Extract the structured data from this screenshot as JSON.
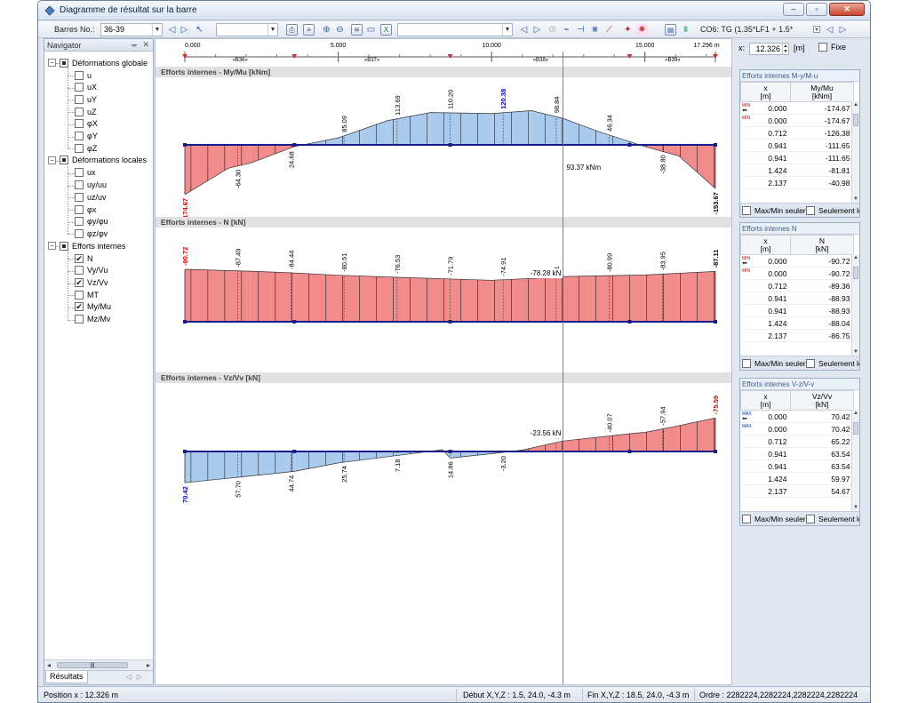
{
  "window": {
    "title": "Diagramme de résultat sur la barre",
    "buttons": [
      "–",
      "▫",
      "✕"
    ]
  },
  "toolbar": {
    "members_label": "Barres No.:",
    "members_value": "36-39",
    "combo2_value": "",
    "combo3_value": "",
    "load_combo": "CO6: TG  (1.35*LF1 + 1.5*"
  },
  "navigator": {
    "title": "Navigator",
    "tab": "Résultats",
    "groups": [
      {
        "label": "Déformations globale",
        "state": "partial",
        "items": [
          {
            "label": "u",
            "checked": false
          },
          {
            "label": "uX",
            "checked": false
          },
          {
            "label": "uY",
            "checked": false
          },
          {
            "label": "uZ",
            "checked": false
          },
          {
            "label": "φX",
            "checked": false
          },
          {
            "label": "φY",
            "checked": false
          },
          {
            "label": "φZ",
            "checked": false
          }
        ]
      },
      {
        "label": "Déformations locales",
        "state": "partial",
        "items": [
          {
            "label": "ux",
            "checked": false
          },
          {
            "label": "uy/uu",
            "checked": false
          },
          {
            "label": "uz/uv",
            "checked": false
          },
          {
            "label": "φx",
            "checked": false
          },
          {
            "label": "φy/φu",
            "checked": false
          },
          {
            "label": "φz/φv",
            "checked": false
          }
        ]
      },
      {
        "label": "Efforts internes",
        "state": "partial",
        "items": [
          {
            "label": "N",
            "checked": true
          },
          {
            "label": "Vy/Vu",
            "checked": false
          },
          {
            "label": "Vz/Vv",
            "checked": true
          },
          {
            "label": "MT",
            "checked": false
          },
          {
            "label": "My/Mu",
            "checked": true
          },
          {
            "label": "Mz/Mv",
            "checked": false
          }
        ]
      }
    ]
  },
  "ruler": {
    "ticks": [
      "0.000",
      "5.000",
      "10.000",
      "15.000",
      "17.296 m"
    ],
    "bars": [
      "»B36»",
      "»B37»",
      "»B38»",
      "»B39»"
    ]
  },
  "position_control": {
    "x_label": "x:",
    "x_value": "12.326",
    "unit": "[m]",
    "fix_label": "Fixe"
  },
  "chart_data": [
    {
      "type": "area",
      "title": "Efforts internes - My/Mu [kNm]",
      "x": [
        0.0,
        1.424,
        2.137,
        3.57,
        5.0,
        6.6,
        8.0,
        10.0,
        11.3,
        12.326,
        13.5,
        15.0,
        16.1,
        17.296
      ],
      "values": [
        -174.67,
        -81.81,
        -64.3,
        -6.0,
        24.68,
        85.09,
        113.69,
        110.2,
        120.38,
        93.37,
        46.34,
        -6.0,
        -38.8,
        -153.67
      ],
      "labels": [
        "-174.67",
        "-64.30",
        "24.68",
        "85.09",
        "113.69",
        "110.20",
        "120.38",
        "98.84",
        "46.34",
        "-38.80",
        "-153.67"
      ],
      "cursor_label": "93.37 kNm"
    },
    {
      "type": "area",
      "title": "Efforts internes - N [kN]",
      "x": [
        0.0,
        2.137,
        3.57,
        5.0,
        7.14,
        10.0,
        11.3,
        12.326,
        15.0,
        16.1,
        17.296
      ],
      "values": [
        -90.72,
        -87.49,
        -84.44,
        -80.51,
        -76.53,
        -71.79,
        -74.91,
        -78.28,
        -80.99,
        -83.95,
        -87.11
      ],
      "labels": [
        "-90.72",
        "-87.49",
        "-84.44",
        "-80.51",
        "-76.53",
        "-71.79",
        "-74.91",
        "91",
        "-80.99",
        "-83.95",
        "-87.11"
      ],
      "cursor_label": "-78.28 kN"
    },
    {
      "type": "area",
      "title": "Efforts internes - Vz/Vv [kN]",
      "x": [
        0.0,
        1.77,
        3.57,
        5.0,
        7.14,
        8.4,
        8.65,
        10.0,
        11.0,
        12.326,
        14.5,
        15.0,
        16.1,
        17.296
      ],
      "values": [
        70.42,
        57.7,
        44.74,
        25.74,
        7.18,
        -4.0,
        14.86,
        5.0,
        -3.2,
        -23.56,
        -40.07,
        -43.0,
        -57.94,
        -75.59
      ],
      "labels": [
        "70.42",
        "57.70",
        "44.74",
        "25.74",
        "7.18",
        "14.86",
        "-3.20",
        "28",
        "-40.07",
        "-57.94",
        "-75.59"
      ],
      "cursor_label": "-23.56 kN"
    }
  ],
  "tables": [
    {
      "title": "Efforts internes M-y/M-u",
      "col1": "x\n[m]",
      "col2": "My/Mu\n[kNm]",
      "flag": "MIN",
      "rows": [
        [
          "0.000",
          "-174.67"
        ],
        [
          "0.000",
          "-174.67"
        ],
        [
          "0.712",
          "-126.38"
        ],
        [
          "0.941",
          "-111.65"
        ],
        [
          "0.941",
          "-111.65"
        ],
        [
          "1.424",
          "-81.81"
        ],
        [
          "2.137",
          "-40.98"
        ]
      ],
      "opt1": "Max/Min seuler",
      "opt2": "Seulement le"
    },
    {
      "title": "Efforts internes N",
      "col1": "x\n[m]",
      "col2": "N\n[kN]",
      "flag": "MIN",
      "rows": [
        [
          "0.000",
          "-90.72"
        ],
        [
          "0.000",
          "-90.72"
        ],
        [
          "0.712",
          "-89.36"
        ],
        [
          "0.941",
          "-88.93"
        ],
        [
          "0.941",
          "-88.93"
        ],
        [
          "1.424",
          "-88.04"
        ],
        [
          "2.137",
          "-86.75"
        ]
      ],
      "opt1": "Max/Min seuler",
      "opt2": "Seulement le"
    },
    {
      "title": "Efforts internes V-z/V-v",
      "col1": "x\n[m]",
      "col2": "Vz/Vv\n[kN]",
      "flag": "MAX",
      "rows": [
        [
          "0.000",
          "70.42"
        ],
        [
          "0.000",
          "70.42"
        ],
        [
          "0.712",
          "65.22"
        ],
        [
          "0.941",
          "63.54"
        ],
        [
          "0.941",
          "63.54"
        ],
        [
          "1.424",
          "59.97"
        ],
        [
          "2.137",
          "54.67"
        ]
      ],
      "opt1": "Max/Min seuler",
      "opt2": "Seulement le"
    }
  ],
  "statusbar": {
    "position": "Position x : 12.326 m",
    "start": "Début X,Y,Z :  1.5, 24.0, -4.3 m",
    "end": "Fin X,Y,Z :  18.5, 24.0, -4.3 m",
    "order": "Ordre :  2282224,2282224,2282224,2282224"
  },
  "colors": {
    "positive": "#f28c8c",
    "negative": "#aacbee",
    "extreme_min": "#e00000",
    "extreme_max": "#0000cc"
  }
}
